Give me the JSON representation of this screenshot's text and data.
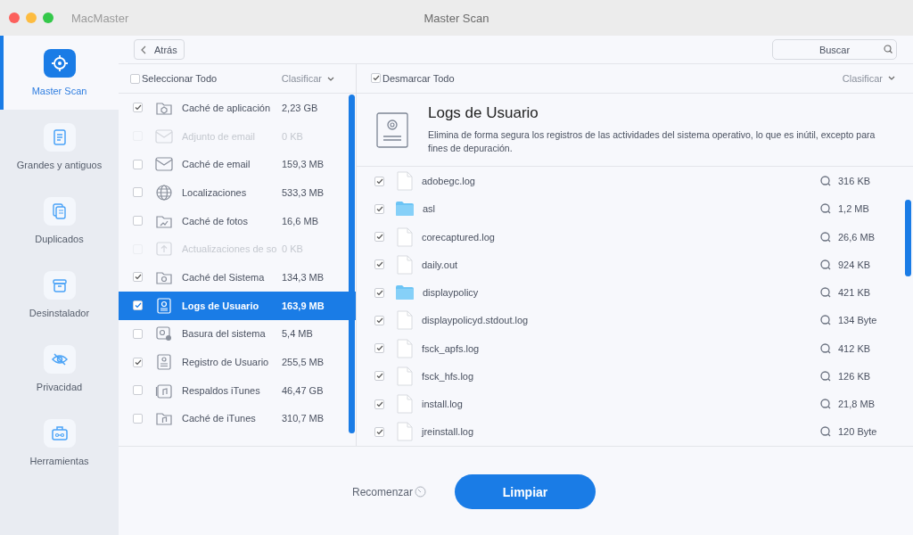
{
  "window": {
    "app_name": "MacMaster",
    "title": "Master Scan"
  },
  "sidebar": {
    "items": [
      {
        "label": "Master Scan",
        "selected": true
      },
      {
        "label": "Grandes y antiguos",
        "selected": false
      },
      {
        "label": "Duplicados",
        "selected": false
      },
      {
        "label": "Desinstalador",
        "selected": false
      },
      {
        "label": "Privacidad",
        "selected": false
      },
      {
        "label": "Herramientas",
        "selected": false
      }
    ]
  },
  "toolbar": {
    "back": "Atrás",
    "search": {
      "placeholder": "Buscar"
    }
  },
  "categories": {
    "select_all": {
      "label": "Seleccionar Todo",
      "checked": false
    },
    "sort": "Clasificar",
    "items": [
      {
        "label": "Caché de aplicación",
        "size": "2,23 GB",
        "checked": true,
        "disabled": false,
        "selected": false
      },
      {
        "label": "Adjunto de email",
        "size": "0 KB",
        "checked": false,
        "disabled": true,
        "selected": false
      },
      {
        "label": "Caché de email",
        "size": "159,3 MB",
        "checked": false,
        "disabled": false,
        "selected": false
      },
      {
        "label": "Localizaciones",
        "size": "533,3 MB",
        "checked": false,
        "disabled": false,
        "selected": false
      },
      {
        "label": "Caché de fotos",
        "size": "16,6 MB",
        "checked": false,
        "disabled": false,
        "selected": false
      },
      {
        "label": "Actualizaciones de so",
        "size": "0 KB",
        "checked": false,
        "disabled": true,
        "selected": false
      },
      {
        "label": "Caché del Sistema",
        "size": "134,3 MB",
        "checked": true,
        "disabled": false,
        "selected": false
      },
      {
        "label": "Logs de Usuario",
        "size": "163,9 MB",
        "checked": true,
        "disabled": false,
        "selected": true
      },
      {
        "label": "Basura del sistema",
        "size": "5,4 MB",
        "checked": false,
        "disabled": false,
        "selected": false
      },
      {
        "label": "Registro de Usuario",
        "size": "255,5 MB",
        "checked": true,
        "disabled": false,
        "selected": false
      },
      {
        "label": "Respaldos iTunes",
        "size": "46,47 GB",
        "checked": false,
        "disabled": false,
        "selected": false
      },
      {
        "label": "Caché de iTunes",
        "size": "310,7 MB",
        "checked": false,
        "disabled": false,
        "selected": false
      }
    ]
  },
  "details": {
    "deselect_all": {
      "label": "Desmarcar Todo",
      "checked": true
    },
    "sort": "Clasificar",
    "title": "Logs de Usuario",
    "description": "Elimina de forma segura los registros de las actividades del sistema operativo, lo que es inútil, excepto para fines de depuración.",
    "files": [
      {
        "name": "adobegc.log",
        "size": "316 KB",
        "kind": "file",
        "checked": true
      },
      {
        "name": "asl",
        "size": "1,2 MB",
        "kind": "folder",
        "checked": true
      },
      {
        "name": "corecaptured.log",
        "size": "26,6 MB",
        "kind": "file",
        "checked": true
      },
      {
        "name": "daily.out",
        "size": "924 KB",
        "kind": "file",
        "checked": true
      },
      {
        "name": "displaypolicy",
        "size": "421 KB",
        "kind": "folder",
        "checked": true
      },
      {
        "name": "displaypolicyd.stdout.log",
        "size": "134 Byte",
        "kind": "file",
        "checked": true
      },
      {
        "name": "fsck_apfs.log",
        "size": "412 KB",
        "kind": "file",
        "checked": true
      },
      {
        "name": "fsck_hfs.log",
        "size": "126 KB",
        "kind": "file",
        "checked": true
      },
      {
        "name": "install.log",
        "size": "21,8 MB",
        "kind": "file",
        "checked": true
      },
      {
        "name": "jreinstall.log",
        "size": "120 Byte",
        "kind": "file",
        "checked": true
      }
    ]
  },
  "footer": {
    "restart": "Recomenzar",
    "clean": "Limpiar"
  }
}
